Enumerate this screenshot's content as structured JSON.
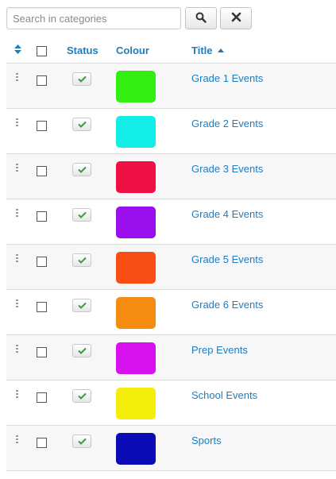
{
  "search": {
    "placeholder": "Search in categories",
    "value": ""
  },
  "toolbar": {
    "search_icon": "search-icon",
    "clear_icon": "close-icon"
  },
  "table": {
    "headers": {
      "order_icon": "sort-arrows-icon",
      "status": "Status",
      "colour": "Colour",
      "title": "Title",
      "title_sort": "ascending"
    },
    "accent_color": "#1f7dbf",
    "rows": [
      {
        "title": "Grade 1 Events",
        "colour": "#33ee11",
        "published": true
      },
      {
        "title": "Grade 2 Events",
        "colour": "#11eee6",
        "published": true
      },
      {
        "title": "Grade 3 Events",
        "colour": "#f00f44",
        "published": true
      },
      {
        "title": "Grade 4 Events",
        "colour": "#9b0eee",
        "published": true
      },
      {
        "title": "Grade 5 Events",
        "colour": "#f84e14",
        "published": true
      },
      {
        "title": "Grade 6 Events",
        "colour": "#f48c11",
        "published": true
      },
      {
        "title": "Prep Events",
        "colour": "#d812ee",
        "published": true
      },
      {
        "title": "School Events",
        "colour": "#f5ee0d",
        "published": true
      },
      {
        "title": "Sports",
        "colour": "#0c0cb7",
        "published": true
      }
    ]
  }
}
